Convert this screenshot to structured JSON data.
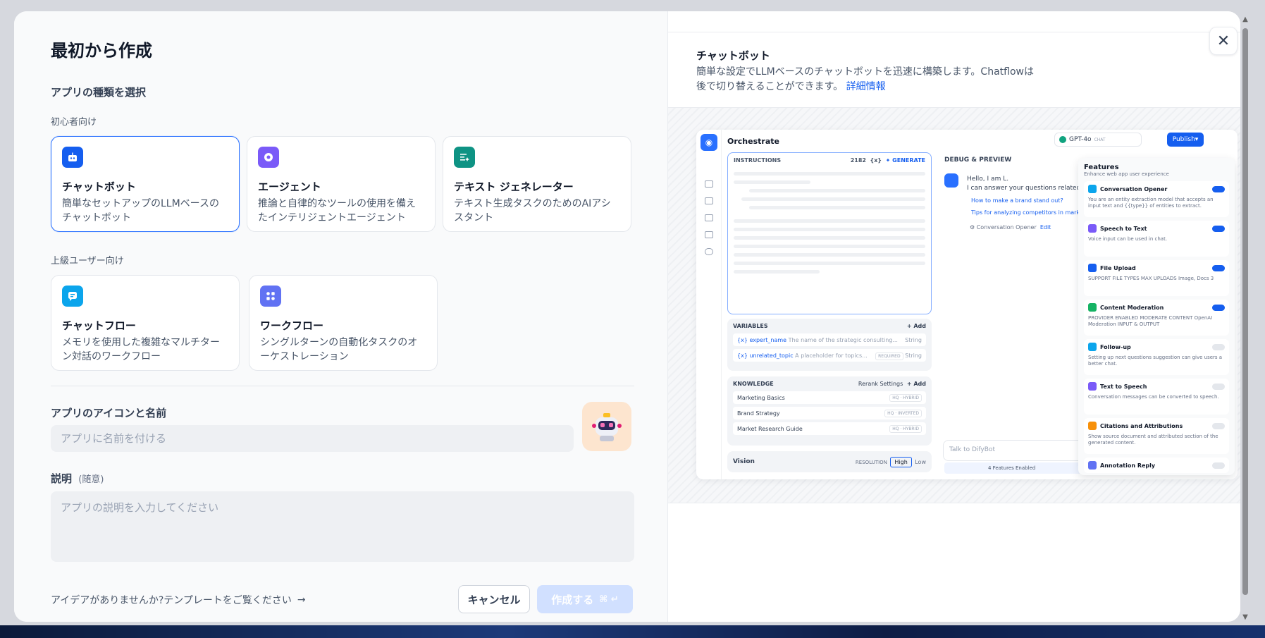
{
  "dialog": {
    "title": "最初から作成",
    "app_type_label": "アプリの種類を選択",
    "beginner_label": "初心者向け",
    "advanced_label": "上級ユーザー向け",
    "beginner_cards": [
      {
        "title": "チャットボット",
        "desc": "簡単なセットアップのLLMベースのチャットボット",
        "icon": "chatbot-icon",
        "color": "#155eef",
        "selected": true
      },
      {
        "title": "エージェント",
        "desc": "推論と自律的なツールの使用を備えたインテリジェントエージェント",
        "icon": "agent-icon",
        "color": "#7a5af8"
      },
      {
        "title": "テキスト ジェネレーター",
        "desc": "テキスト生成タスクのためのAIアシスタント",
        "icon": "text-generator-icon",
        "color": "#0e9384"
      }
    ],
    "advanced_cards": [
      {
        "title": "チャットフロー",
        "desc": "メモリを使用した複雑なマルチターン対話のワークフロー",
        "icon": "chatflow-icon",
        "color": "#0ba5ec"
      },
      {
        "title": "ワークフロー",
        "desc": "シングルターンの自動化タスクのオーケストレーション",
        "icon": "workflow-icon",
        "color": "#6172f3"
      }
    ],
    "icon_name_label": "アプリのアイコンと名前",
    "name_placeholder": "アプリに名前を付ける",
    "desc_label": "説明",
    "desc_optional": "(随意)",
    "desc_placeholder": "アプリの説明を入力してください",
    "template_link": "アイデアがありませんか?テンプレートをご覧ください",
    "cancel": "キャンセル",
    "create": "作成する",
    "create_shortcut": "⌘ ↵"
  },
  "preview_info": {
    "title": "チャットボット",
    "desc": "簡単な設定でLLMベースのチャットボットを迅速に構築します。Chatflowは後で切り替えることができます。",
    "more": "詳細情報"
  },
  "preview": {
    "header": "Orchestrate",
    "model": "GPT-4o",
    "model_tag": "CHAT",
    "publish": "Publish",
    "instructions": "INSTRUCTIONS",
    "count": "2182",
    "generate": "GENERATE",
    "variables": "VARIABLES",
    "add": "+ Add",
    "vars": [
      {
        "name": "{x} expert_name",
        "hint": "The name of the strategic consulting...",
        "type": "String"
      },
      {
        "name": "{x} unrelated_topic",
        "hint": "A placeholder for topics...",
        "tag": "REQUIRED",
        "type": "String"
      }
    ],
    "knowledge": "KNOWLEDGE",
    "rerank": "Rerank Settings",
    "kb": [
      {
        "name": "Marketing Basics",
        "tag": "HQ · HYBRID"
      },
      {
        "name": "Brand Strategy",
        "tag": "HQ · INVERTED"
      },
      {
        "name": "Market Research Guide",
        "tag": "HQ · HYBRID"
      }
    ],
    "vision": "Vision",
    "resolution": "RESOLUTION",
    "high": "High",
    "low": "Low",
    "debug": "DEBUG & PREVIEW",
    "hello1": "Hello, I am L.",
    "hello2": "I can answer your questions related",
    "sugg1": "How to make a brand stand out?",
    "sugg2": "Tips for analyzing competitors in market",
    "opener": "Conversation Opener",
    "edit": "Edit",
    "talk": "Talk to DifyBot",
    "enabled": "4 Features Enabled",
    "features_title": "Features",
    "features_sub": "Enhance web app user experience",
    "features": [
      {
        "name": "Conversation Opener",
        "desc": "You are an entity extraction model that accepts an input text and {{type}} of entities to extract.",
        "color": "#0ba5ec",
        "on": true
      },
      {
        "name": "Speech to Text",
        "desc": "Voice input can be used in chat.",
        "color": "#7a5af8",
        "on": true
      },
      {
        "name": "File Upload",
        "desc": "SUPPORT FILE TYPES   MAX UPLOADS   Image, Docs   3",
        "color": "#155eef",
        "on": true
      },
      {
        "name": "Content Moderation",
        "desc": "PROVIDER   ENABLED MODERATE CONTENT   OpenAI Moderation   INPUT & OUTPUT",
        "color": "#16b364",
        "on": true
      },
      {
        "name": "Follow-up",
        "desc": "Setting up next questions suggestion can give users a better chat.",
        "color": "#0ba5ec",
        "on": false
      },
      {
        "name": "Text to Speech",
        "desc": "Conversation messages can be converted to speech.",
        "color": "#7a5af8",
        "on": false
      },
      {
        "name": "Citations and Attributions",
        "desc": "Show source document and attributed section of the generated content.",
        "color": "#f79009",
        "on": false
      },
      {
        "name": "Annotation Reply",
        "desc": "",
        "color": "#6172f3",
        "on": false
      }
    ]
  }
}
